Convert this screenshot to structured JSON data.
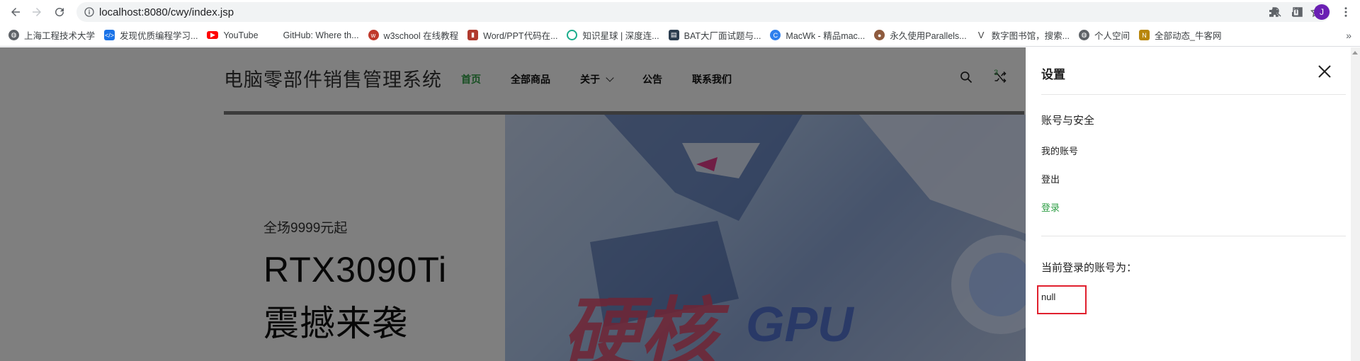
{
  "browser": {
    "url": "localhost:8080/cwy/index.jsp",
    "profile_initial": "J"
  },
  "bookmarks": [
    {
      "label": "上海工程技术大学",
      "icon": "globe-icon",
      "color": "#5f6368"
    },
    {
      "label": "发现优质编程学习...",
      "icon": "code-icon",
      "color": "#1a73e8"
    },
    {
      "label": "YouTube",
      "icon": "youtube-icon",
      "color": "#ff0000"
    },
    {
      "label": "GitHub: Where th...",
      "icon": "",
      "color": "#ffffff"
    },
    {
      "label": "w3school 在线教程",
      "icon": "w3school-icon",
      "color": "#c0392b"
    },
    {
      "label": "Word/PPT代码在...",
      "icon": "bookmark-icon",
      "color": "#b03a2e"
    },
    {
      "label": "知识星球 | 深度连...",
      "icon": "zsxq-icon",
      "color": "#1aad8c"
    },
    {
      "label": "BAT大厂面试题与...",
      "icon": "doc-icon",
      "color": "#2c3e50"
    },
    {
      "label": "MacWk - 精品mac...",
      "icon": "macwk-icon",
      "color": "#2f80ed"
    },
    {
      "label": "永久使用Parallels...",
      "icon": "avatar-icon",
      "color": "#8e5b3e"
    },
    {
      "label": "数字图书馆，搜索...",
      "icon": "v-icon",
      "color": "#444444"
    },
    {
      "label": "个人空间",
      "icon": "globe-icon",
      "color": "#5f6368"
    },
    {
      "label": "全部动态_牛客网",
      "icon": "nowcoder-icon",
      "color": "#b8860b"
    }
  ],
  "site": {
    "title": "电脑零部件销售管理系统",
    "nav": [
      {
        "label": "首页",
        "active": true
      },
      {
        "label": "全部商品",
        "active": false
      },
      {
        "label": "关于",
        "active": false,
        "dropdown": true
      },
      {
        "label": "公告",
        "active": false
      },
      {
        "label": "联系我们",
        "active": false
      }
    ],
    "compare_count": "3"
  },
  "hero": {
    "subhead": "全场9999元起",
    "headline_1": "RTX3090Ti",
    "headline_2": "震撼来袭"
  },
  "drawer": {
    "title": "设置",
    "account_security": "账号与安全",
    "my_account": "我的账号",
    "logout": "登出",
    "login": "登录",
    "current_account_label": "当前登录的账号为：",
    "current_account_value": "null"
  },
  "colors": {
    "accent_green": "#2e9e45",
    "highlight_red": "#e0202e"
  }
}
